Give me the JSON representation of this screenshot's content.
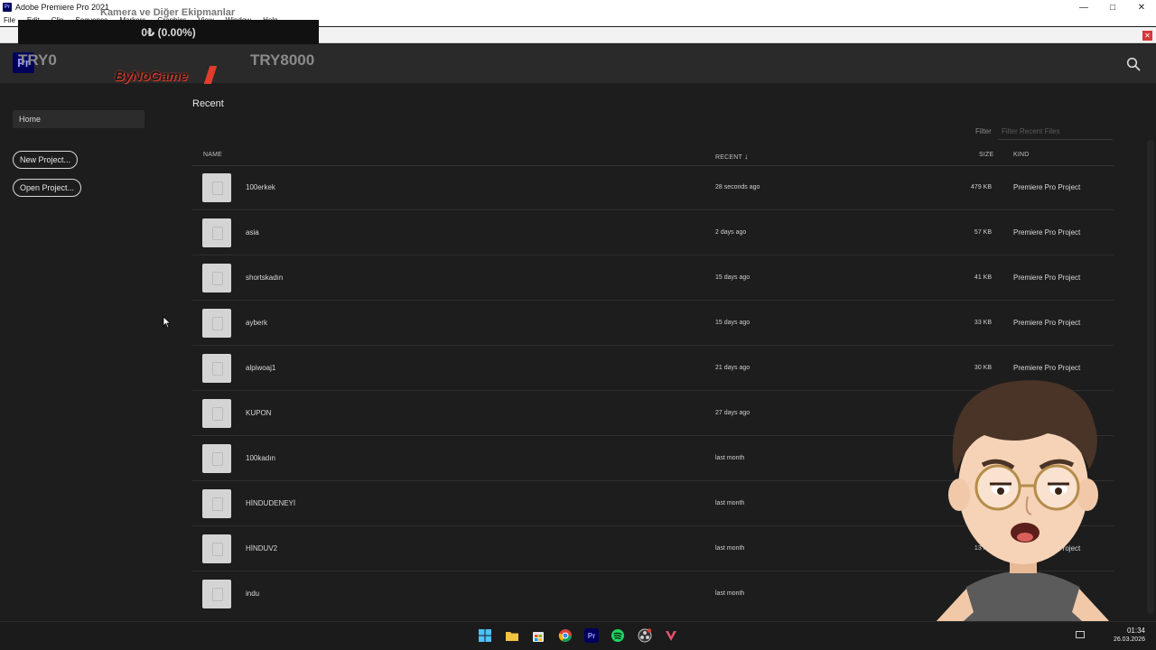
{
  "window": {
    "title": "Adobe Premiere Pro 2021",
    "app_icon": "Pr"
  },
  "menu": [
    "File",
    "Edit",
    "Clip",
    "Sequence",
    "Markers",
    "Graphics",
    "View",
    "Window",
    "Help"
  ],
  "overlay": {
    "donation_title": "Kamera ve Diğer Ekipmanlar",
    "donation_amount": "0₺ (0.00%)",
    "goal_left": "TRY0",
    "goal_right": "TRY8000",
    "brand": "ByNoGame"
  },
  "header": {
    "logo": "Pr",
    "search_icon": "search-icon"
  },
  "sidebar": {
    "home_label": "Home",
    "new_project_label": "New Project...",
    "open_project_label": "Open Project..."
  },
  "main": {
    "section_title": "Recent",
    "filter_label": "Filter",
    "filter_placeholder": "Filter Recent Files",
    "columns": {
      "name": "NAME",
      "recent": "RECENT",
      "size": "SIZE",
      "kind": "KIND"
    },
    "files": [
      {
        "name": "100erkek",
        "recent": "28 seconds ago",
        "size": "479 KB",
        "kind": "Premiere Pro Project"
      },
      {
        "name": "asia",
        "recent": "2 days ago",
        "size": "57 KB",
        "kind": "Premiere Pro Project"
      },
      {
        "name": "shortskadın",
        "recent": "15 days ago",
        "size": "41 KB",
        "kind": "Premiere Pro Project"
      },
      {
        "name": "ayberk",
        "recent": "15 days ago",
        "size": "33 KB",
        "kind": "Premiere Pro Project"
      },
      {
        "name": "alpiwoaj1",
        "recent": "21 days ago",
        "size": "30 KB",
        "kind": "Premiere Pro Project"
      },
      {
        "name": "KUPON",
        "recent": "27 days ago",
        "size": "",
        "kind": ""
      },
      {
        "name": "100kadın",
        "recent": "last month",
        "size": "",
        "kind": ""
      },
      {
        "name": "HİNDUDENEYİ",
        "recent": "last month",
        "size": "",
        "kind": ""
      },
      {
        "name": "HİNDUV2",
        "recent": "last month",
        "size": "13 KB",
        "kind": "Premiere Pro Project"
      },
      {
        "name": "indu",
        "recent": "last month",
        "size": "",
        "kind": ""
      }
    ]
  },
  "taskbar": {
    "time": "01:34",
    "date": "26.03.2026",
    "apps": [
      "windows-start-icon",
      "file-explorer-icon",
      "store-icon",
      "chrome-icon",
      "premiere-icon",
      "spotify-icon",
      "obs-icon",
      "app-v-icon"
    ]
  },
  "colors": {
    "background": "#1d1d1d",
    "header": "#2a2a2a",
    "premiere_blue": "#00005b",
    "premiere_text": "#9999ff",
    "brand_red": "#e23c2c"
  }
}
